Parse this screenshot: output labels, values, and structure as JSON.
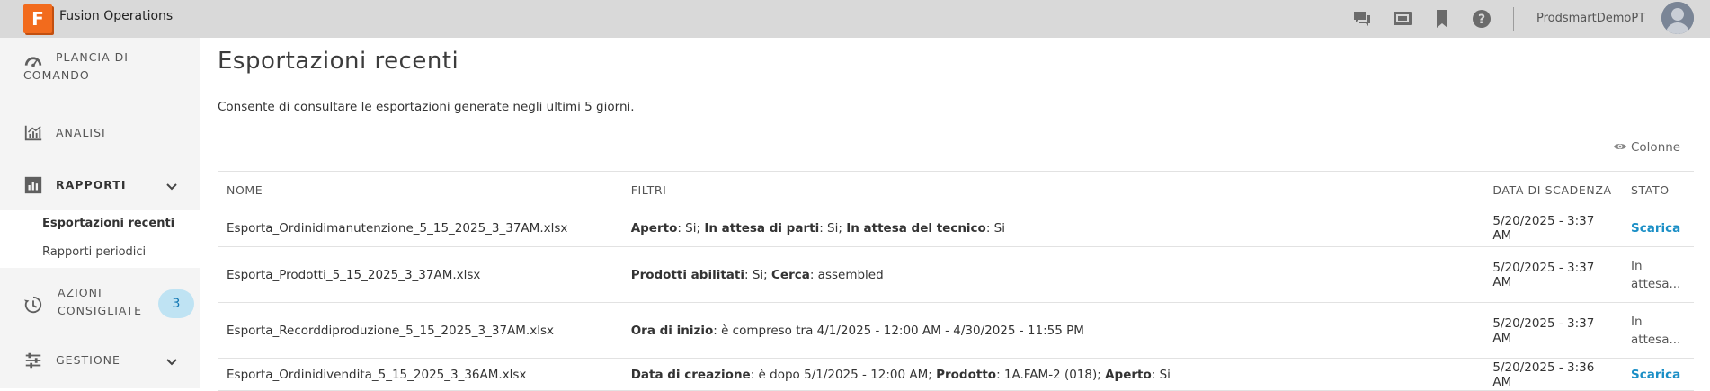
{
  "app": {
    "logo_letter": "F",
    "title": "Fusion Operations",
    "username": "ProdsmartDemoPT"
  },
  "topbar_icons": [
    "chat-icon",
    "display-icon",
    "bookmark-icon",
    "help-icon"
  ],
  "sidebar": {
    "items": [
      {
        "id": "dashboard",
        "line1": "PLANCIA DI",
        "line2": "COMANDO",
        "icon": "gauge-icon"
      },
      {
        "id": "analysis",
        "label": "ANALISI",
        "icon": "chart-icon"
      },
      {
        "id": "reports",
        "label": "RAPPORTI",
        "icon": "report-icon"
      },
      {
        "id": "actions",
        "line1": "AZIONI",
        "line2": "CONSIGLIATE",
        "badge": "3",
        "icon": "history-icon"
      },
      {
        "id": "management",
        "label": "GESTIONE",
        "icon": "sliders-icon"
      }
    ],
    "sub_items": [
      {
        "label": "Esportazioni recenti",
        "active": true
      },
      {
        "label": "Rapporti periodici",
        "active": false
      }
    ]
  },
  "main": {
    "title": "Esportazioni recenti",
    "description": "Consente di consultare le esportazioni generate negli ultimi 5 giorni.",
    "columns_button": "Colonne",
    "table": {
      "headers": {
        "name": "NOME",
        "filters": "FILTRI",
        "expiry": "DATA DI SCADENZA",
        "status": "STATO"
      },
      "rows": [
        {
          "name": "Esporta_Ordinidimanutenzione_5_15_2025_3_37AM.xlsx",
          "filters": [
            {
              "key": "Aperto",
              "value": ": Si; "
            },
            {
              "key": "In attesa di parti",
              "value": ": Si; "
            },
            {
              "key": "In attesa del tecnico",
              "value": ": Si"
            }
          ],
          "expiry": "5/20/2025 - 3:37 AM",
          "status": "Scarica"
        },
        {
          "name": "Esporta_Prodotti_5_15_2025_3_37AM.xlsx",
          "filters": [
            {
              "key": "Prodotti abilitati",
              "value": ": Si; "
            },
            {
              "key": "Cerca",
              "value": ": assembled"
            }
          ],
          "expiry": "5/20/2025 - 3:37 AM",
          "status": "In attesa..."
        },
        {
          "name": "Esporta_Recorddiproduzione_5_15_2025_3_37AM.xlsx",
          "filters": [
            {
              "key": "Ora di inizio",
              "value": ": è compreso tra 4/1/2025 - 12:00 AM - 4/30/2025 - 11:55 PM"
            }
          ],
          "expiry": "5/20/2025 - 3:37 AM",
          "status": "In attesa..."
        },
        {
          "name": "Esporta_Ordinidivendita_5_15_2025_3_36AM.xlsx",
          "filters": [
            {
              "key": "Data di creazione",
              "value": ": è dopo 5/1/2025 - 12:00 AM; "
            },
            {
              "key": "Prodotto",
              "value": ": 1A.FAM-2 (018); "
            },
            {
              "key": "Aperto",
              "value": ": Si"
            }
          ],
          "expiry": "5/20/2025 - 3:36 AM",
          "status": "Scarica"
        }
      ]
    }
  },
  "colors": {
    "accent": "#1b8fc6",
    "logo": "#f26b1d",
    "badge_bg": "#bfe3f3",
    "topbar": "#d9d9d9",
    "sidebar": "#f4f4f4"
  }
}
